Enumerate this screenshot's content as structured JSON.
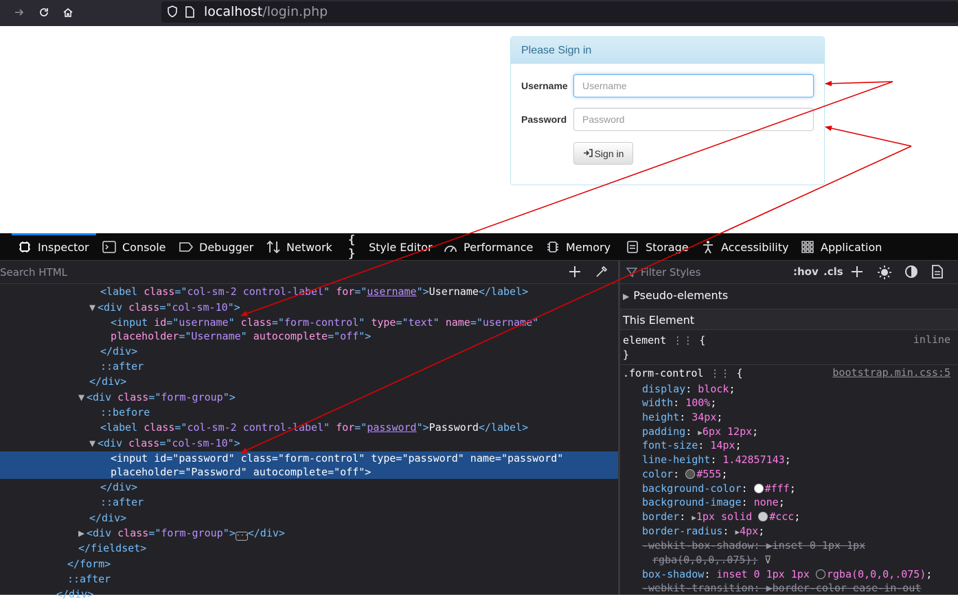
{
  "browser": {
    "url_host": "localhost",
    "url_path": "/login.php"
  },
  "login": {
    "heading": "Please Sign in",
    "username_label": "Username",
    "username_placeholder": "Username",
    "password_label": "Password",
    "password_placeholder": "Password",
    "signin_label": "Sign in"
  },
  "devtools": {
    "tabs": [
      "Inspector",
      "Console",
      "Debugger",
      "Network",
      "Style Editor",
      "Performance",
      "Memory",
      "Storage",
      "Accessibility",
      "Application"
    ],
    "active_tab": "Inspector",
    "search_placeholder": "Search HTML",
    "filter_placeholder": "Filter Styles",
    "hov": ":hov",
    "cls": ".cls",
    "pseudo_elements": "Pseudo-elements",
    "this_element": "This Element",
    "element_rule": "element",
    "element_source": "inline",
    "form_control_selector": ".form-control",
    "form_control_source": "bootstrap.min.css:5"
  },
  "colors": {
    "accent": "#0a84ff",
    "selected_row": "#204e8a",
    "arrow": "#e00000",
    "panel_heading": "#31708f"
  }
}
